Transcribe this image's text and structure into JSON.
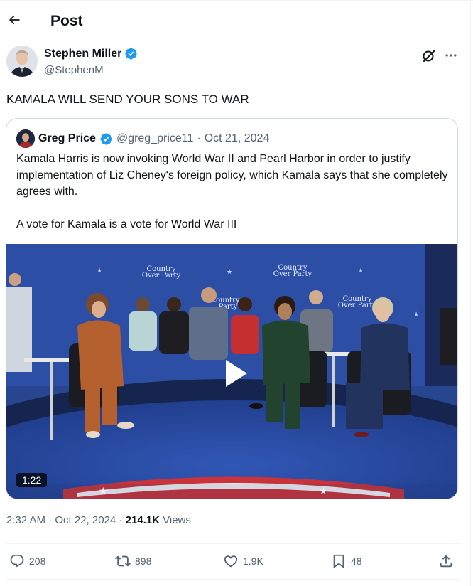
{
  "header": {
    "title": "Post"
  },
  "author": {
    "name": "Stephen Miller",
    "handle": "@StephenM"
  },
  "tweet": {
    "text": "KAMALA WILL SEND YOUR SONS TO WAR"
  },
  "quote": {
    "name": "Greg Price",
    "handle": "@greg_price11",
    "separator": "·",
    "date": "Oct 21, 2024",
    "paragraph1": "Kamala Harris is now invoking World War II and Pearl Harbor in order to justify implementation of Liz Cheney's foreign policy, which Kamala says that she completely agrees with.",
    "paragraph2": "A vote for Kamala is a vote for World War III",
    "video": {
      "duration": "1:22",
      "banner_text": "Country\nOver Party"
    }
  },
  "meta": {
    "time_date": "2:32 AM · Oct 22, 2024 · ",
    "views_count": "214.1K",
    "views_label": " Views"
  },
  "actions": {
    "replies": "208",
    "reposts": "898",
    "likes": "1.9K",
    "bookmarks": "48"
  },
  "colors": {
    "verified": "#1d9bf0",
    "muted": "#536471",
    "text": "#0f1419"
  }
}
